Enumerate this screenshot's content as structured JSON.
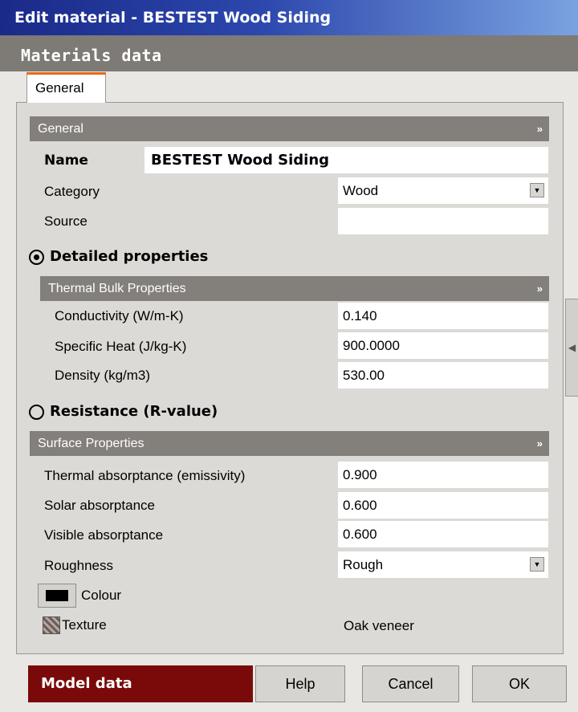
{
  "window": {
    "title": "Edit material - BESTEST Wood Siding"
  },
  "header": {
    "title": "Materials data"
  },
  "tabs": [
    {
      "label": "General"
    }
  ],
  "general": {
    "section_title": "General",
    "name_label": "Name",
    "name_value": "BESTEST Wood Siding",
    "category_label": "Category",
    "category_value": "Wood",
    "source_label": "Source",
    "source_value": ""
  },
  "detailed": {
    "label": "Detailed properties",
    "selected": true,
    "section_title": "Thermal Bulk Properties",
    "conductivity_label": "Conductivity (W/m-K)",
    "conductivity_value": "0.140",
    "specific_heat_label": "Specific Heat (J/kg-K)",
    "specific_heat_value": "900.0000",
    "density_label": "Density (kg/m3)",
    "density_value": "530.00"
  },
  "resistance": {
    "label": "Resistance (R-value)",
    "selected": false
  },
  "surface": {
    "section_title": "Surface Properties",
    "thermal_abs_label": "Thermal absorptance (emissivity)",
    "thermal_abs_value": "0.900",
    "solar_abs_label": "Solar absorptance",
    "solar_abs_value": "0.600",
    "visible_abs_label": "Visible absorptance",
    "visible_abs_value": "0.600",
    "roughness_label": "Roughness",
    "roughness_value": "Rough",
    "colour_label": "Colour",
    "colour_value": "#000000",
    "texture_label": "Texture",
    "texture_value": "Oak veneer"
  },
  "footer": {
    "model_data_label": "Model data",
    "help_label": "Help",
    "cancel_label": "Cancel",
    "ok_label": "OK"
  },
  "colors": {
    "title_bar": "#1a2a88",
    "header_bar": "#7e7a75",
    "section_bar": "#837f7a",
    "tab_accent": "#e66a1a",
    "model_data": "#7a0a0a"
  }
}
